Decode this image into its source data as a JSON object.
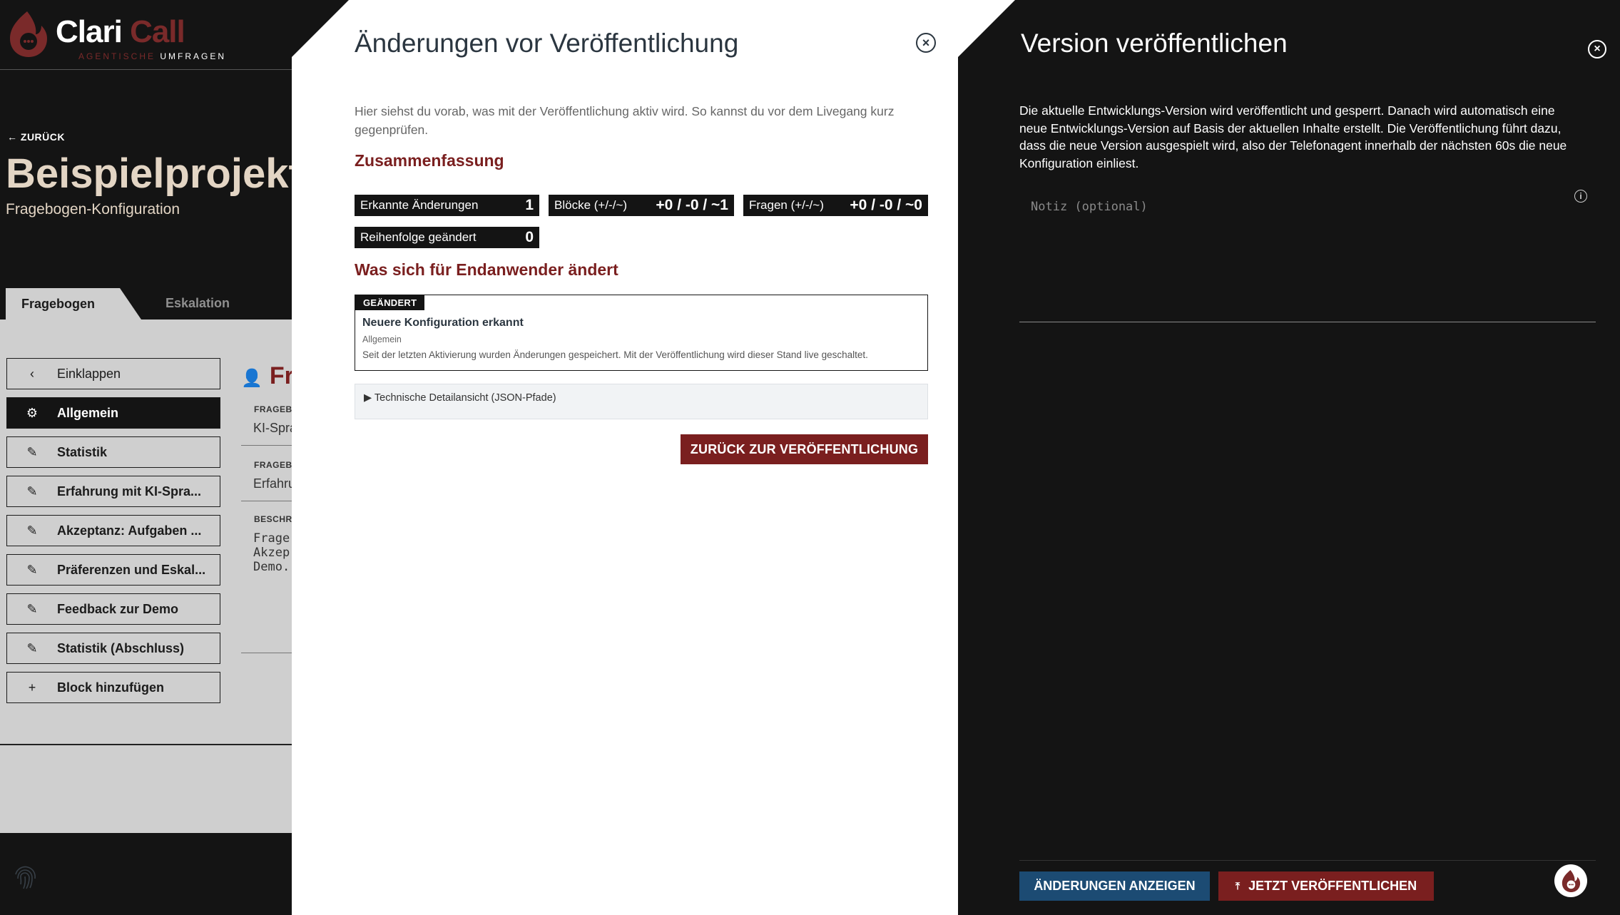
{
  "brand": {
    "name_part1": "Clari",
    "name_part2": "Call",
    "tagline_part1": "AGENTISCHE",
    "tagline_part2": "UMFRAGEN",
    "accent": "#7a2a2a"
  },
  "header": {
    "back_label": "ZURÜCK",
    "project_title": "Beispielprojekt",
    "project_subtitle": "Fragebogen-Konfiguration"
  },
  "tabs": [
    {
      "label": "Fragebogen"
    },
    {
      "label": "Eskalation"
    }
  ],
  "sidebar": {
    "items": [
      {
        "label": "Einklappen",
        "icon": "chevron-left-icon"
      },
      {
        "label": "Allgemein",
        "icon": "gear-icon"
      },
      {
        "label": "Statistik",
        "icon": "pencil-icon"
      },
      {
        "label": "Erfahrung mit KI-Spra...",
        "icon": "pencil-icon"
      },
      {
        "label": "Akzeptanz: Aufgaben ...",
        "icon": "pencil-icon"
      },
      {
        "label": "Präferenzen und Eskal...",
        "icon": "pencil-icon"
      },
      {
        "label": "Feedback zur Demo",
        "icon": "pencil-icon"
      },
      {
        "label": "Statistik (Abschluss)",
        "icon": "pencil-icon"
      },
      {
        "label": "Block hinzufügen",
        "icon": "plus-icon"
      }
    ]
  },
  "background_form": {
    "heading": "Fr",
    "field1_label": "FRAGEBO",
    "field1_value": "KI-Spra",
    "field2_label": "FRAGEBO",
    "field2_value": "Erfahru",
    "field3_label": "BESCHRE",
    "field3_line1": "Frage",
    "field3_line2": "Akzep",
    "field3_line3": "Demo."
  },
  "modal": {
    "title": "Änderungen vor Veröffentlichung",
    "intro": "Hier siehst du vorab, was mit der Veröffentlichung aktiv wird. So kannst du vor dem Livegang kurz gegenprüfen.",
    "summary_heading": "Zusammenfassung",
    "stats": [
      {
        "label": "Erkannte Änderungen",
        "value": "1"
      },
      {
        "label": "Blöcke (+/-/~)",
        "value": "+0 / -0 / ~1"
      },
      {
        "label": "Fragen (+/-/~)",
        "value": "+0 / -0 / ~0"
      },
      {
        "label": "Reihenfolge geändert",
        "value": "0"
      }
    ],
    "enduser_heading": "Was sich für Endanwender ändert",
    "change": {
      "badge": "GEÄNDERT",
      "title": "Neuere Konfiguration erkannt",
      "category": "Allgemein",
      "description": "Seit der letzten Aktivierung wurden Änderungen gespeichert. Mit der Veröffentlichung wird dieser Stand live geschaltet."
    },
    "details_label": "▶ Technische Detailansicht (JSON-Pfade)",
    "back_button": "ZURÜCK ZUR VERÖFFENTLICHUNG"
  },
  "drawer": {
    "title": "Version veröffentlichen",
    "description": "Die aktuelle Entwicklungs-Version wird veröffentlicht und gesperrt. Danach wird automatisch eine neue Entwicklungs-Version auf Basis der aktuellen Inhalte erstellt. Die Veröffentlichung führt dazu, dass die neue Version ausgespielt wird, also der Telefonagent innerhalb der nächsten 60s die neue Konfiguration einliest.",
    "note_placeholder": "Notiz (optional)",
    "show_changes_button": "ÄNDERUNGEN ANZEIGEN",
    "publish_button": "JETZT VERÖFFENTLICHEN"
  },
  "colors": {
    "primary_red": "#7a1f1f",
    "primary_blue": "#1c4b73",
    "dark": "#141414"
  }
}
